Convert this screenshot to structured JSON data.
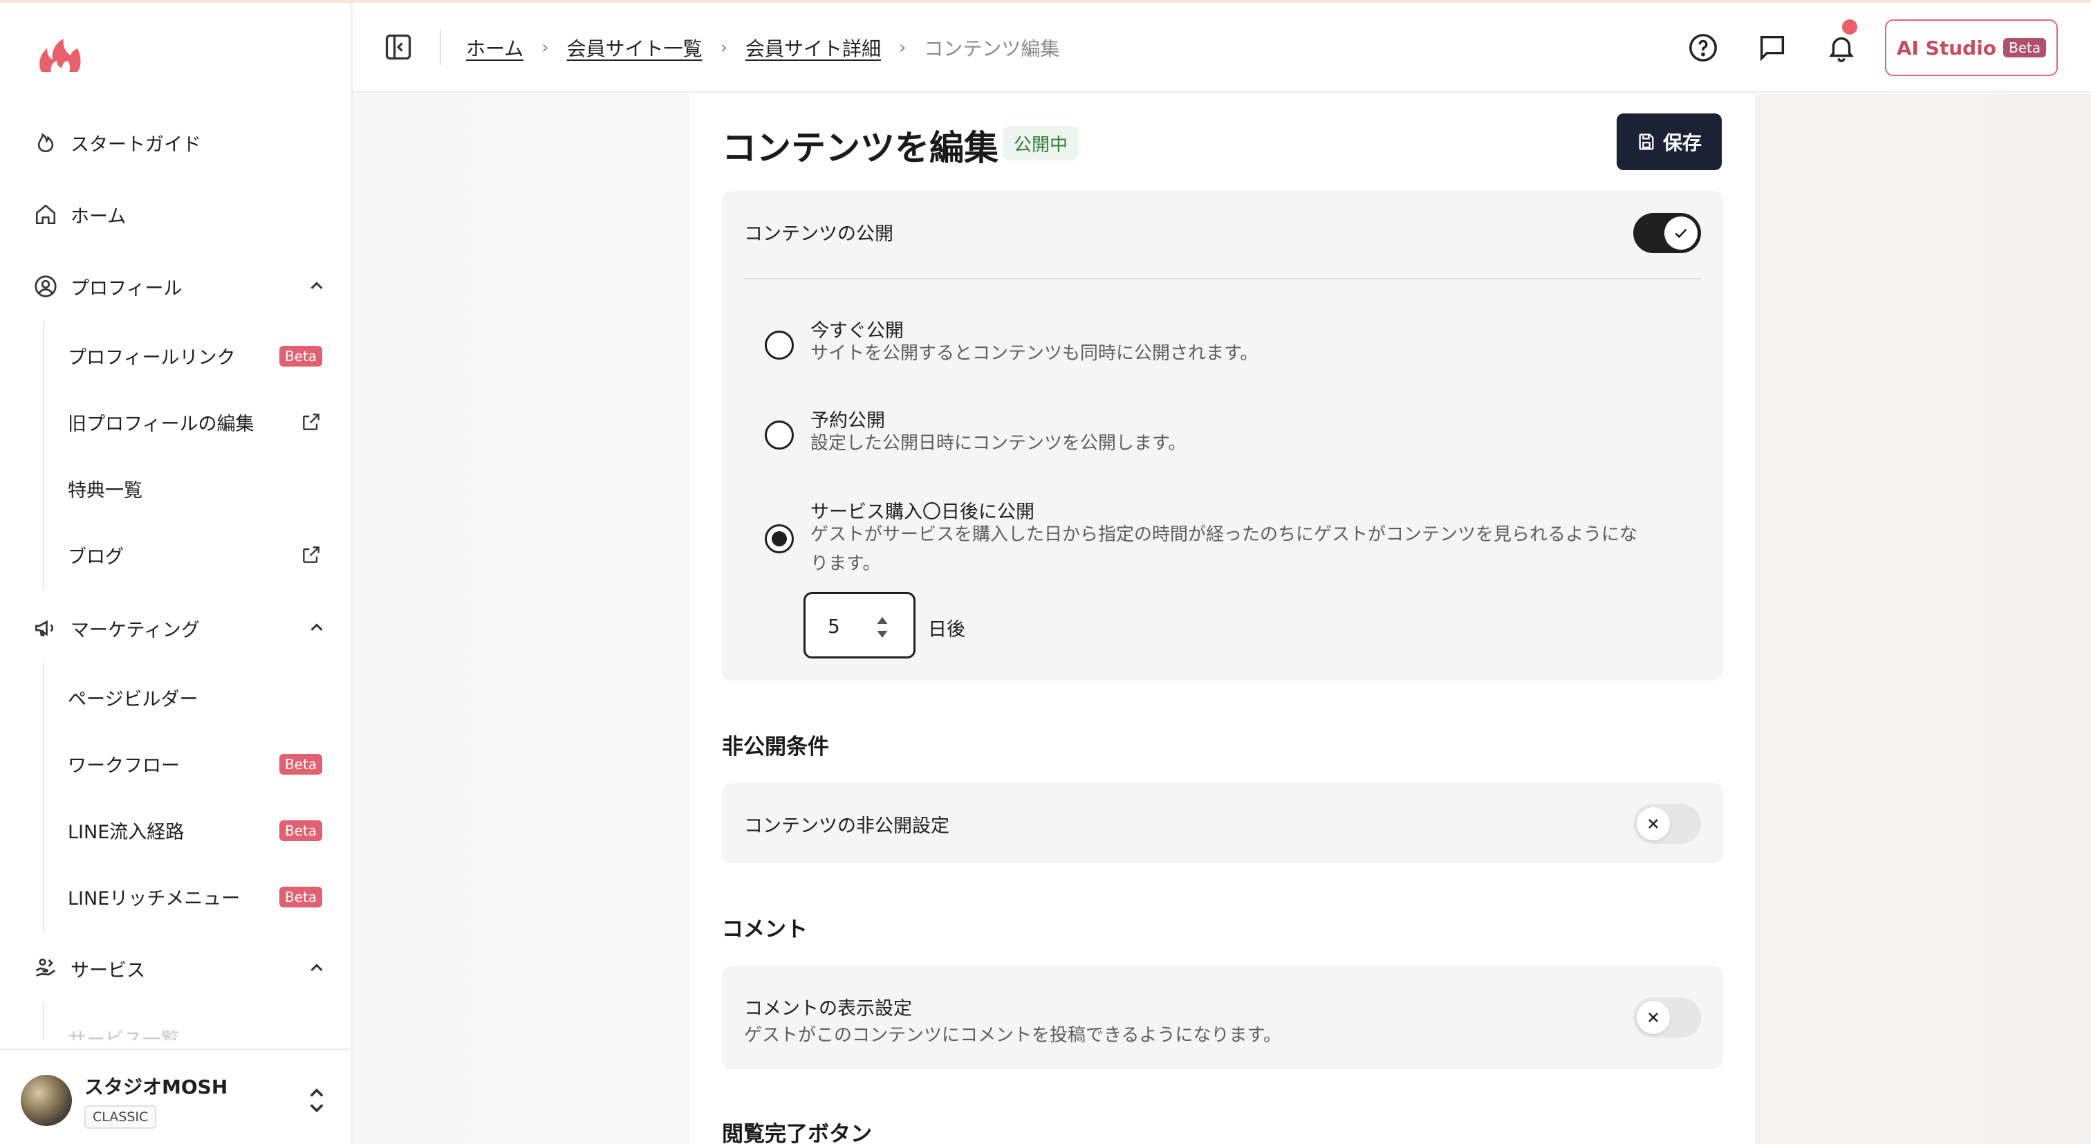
{
  "sidebar": {
    "nav": [
      {
        "label": "スタートガイド",
        "icon": "flame-icon"
      },
      {
        "label": "ホーム",
        "icon": "home-icon"
      },
      {
        "label": "プロフィール",
        "icon": "user-circle-icon"
      },
      {
        "label": "マーケティング",
        "icon": "megaphone-icon"
      },
      {
        "label": "サービス",
        "icon": "hand-icon"
      }
    ],
    "profile_sub": [
      {
        "label": "プロフィールリンク",
        "badge": "Beta"
      },
      {
        "label": "旧プロフィールの編集"
      },
      {
        "label": "特典一覧"
      },
      {
        "label": "ブログ"
      }
    ],
    "marketing_sub": [
      {
        "label": "ページビルダー"
      },
      {
        "label": "ワークフロー",
        "badge": "Beta"
      },
      {
        "label": "LINE流入経路",
        "badge": "Beta"
      },
      {
        "label": "LINEリッチメニュー",
        "badge": "Beta"
      }
    ],
    "service_sub": [
      {
        "label": "サービス一覧"
      }
    ],
    "account": {
      "name": "スタジオMOSH",
      "plan": "CLASSIC"
    }
  },
  "header": {
    "breadcrumb": [
      "ホーム",
      "会員サイト一覧",
      "会員サイト詳細"
    ],
    "breadcrumb_current": "コンテンツ編集",
    "ai_studio": "AI Studio",
    "ai_studio_badge": "Beta"
  },
  "main": {
    "title": "コンテンツを編集",
    "status": "公開中",
    "save_label": "保存",
    "publish": {
      "label": "コンテンツの公開",
      "enabled": true,
      "options": [
        {
          "title": "今すぐ公開",
          "desc": "サイトを公開するとコンテンツも同時に公開されます。",
          "selected": false
        },
        {
          "title": "予約公開",
          "desc": "設定した公開日時にコンテンツを公開します。",
          "selected": false
        },
        {
          "title": "サービス購入〇日後に公開",
          "desc": "ゲストがサービスを購入した日から指定の時間が経ったのちにゲストがコンテンツを見られるようになります。",
          "selected": true
        }
      ],
      "days_value": "5",
      "days_suffix": "日後"
    },
    "unpublish": {
      "section_title": "非公開条件",
      "label": "コンテンツの非公開設定",
      "enabled": false
    },
    "comment": {
      "section_title": "コメント",
      "label": "コメントの表示設定",
      "desc": "ゲストがこのコンテンツにコメントを投稿できるようになります。",
      "enabled": false
    },
    "completion": {
      "section_title": "閲覧完了ボタン"
    }
  },
  "colors": {
    "brand": "#e8606a",
    "dark": "#1b2233",
    "success": "#2e7d32",
    "beta": "#e2606f"
  }
}
